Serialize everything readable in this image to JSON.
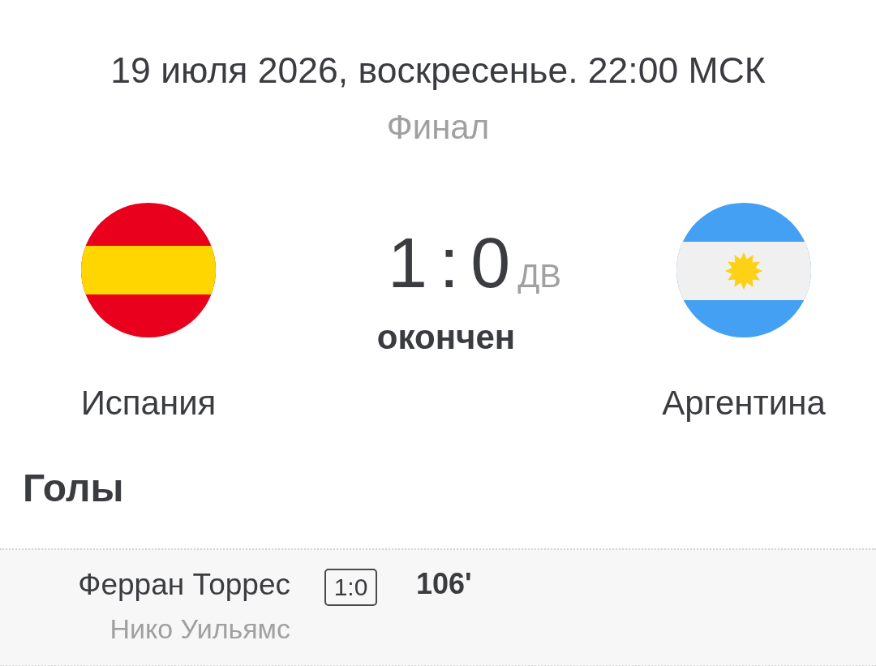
{
  "header": {
    "date_time": "19 июля 2026, воскресенье. 22:00 МСК",
    "stage": "Финал"
  },
  "teams": [
    {
      "name": "Испания"
    },
    {
      "name": "Аргентина"
    }
  ],
  "score": {
    "result": "1 : 0",
    "note": "ДВ",
    "status": "окончен"
  },
  "goals": {
    "title": "Голы",
    "items": [
      {
        "scorer": "Ферран Торрес",
        "assist": "Нико Уильямс",
        "score": "1:0",
        "minute": "106'"
      }
    ]
  }
}
